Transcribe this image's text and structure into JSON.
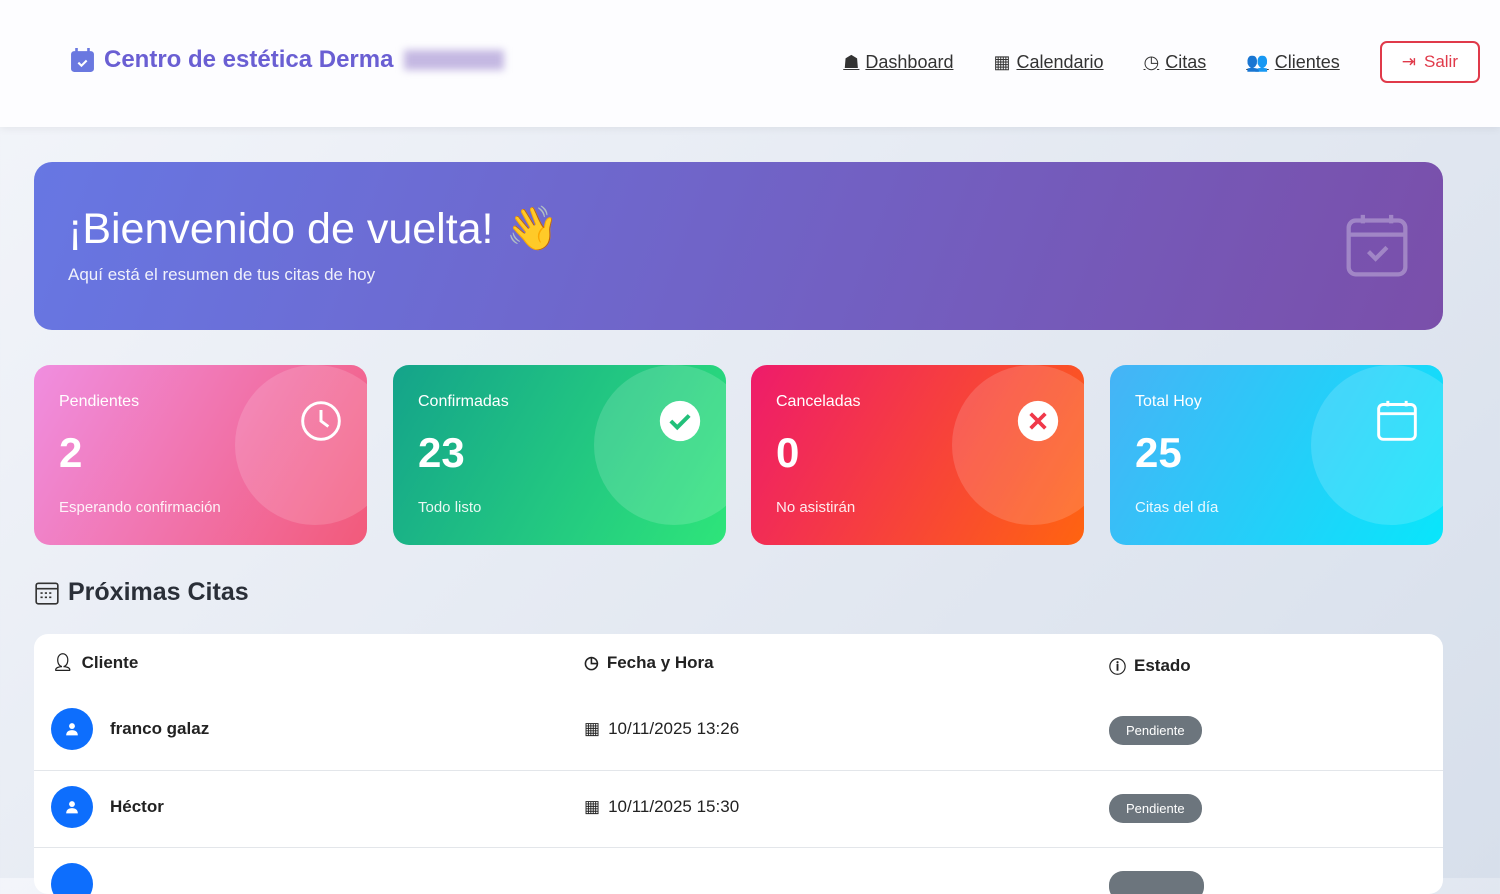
{
  "header": {
    "brand": "Centro de estética Derma",
    "nav": [
      {
        "label": "Dashboard",
        "icon": "home-icon"
      },
      {
        "label": "Calendario",
        "icon": "calendar-icon"
      },
      {
        "label": "Citas",
        "icon": "clock-icon"
      },
      {
        "label": "Clientes",
        "icon": "users-icon"
      }
    ],
    "logout": "Salir"
  },
  "hero": {
    "title": "¡Bienvenido de vuelta! 👋",
    "subtitle": "Aquí está el resumen de tus citas de hoy"
  },
  "stats": [
    {
      "title": "Pendientes",
      "value": "2",
      "sub": "Esperando confirmación"
    },
    {
      "title": "Confirmadas",
      "value": "23",
      "sub": "Todo listo"
    },
    {
      "title": "Canceladas",
      "value": "0",
      "sub": "No asistirán"
    },
    {
      "title": "Total Hoy",
      "value": "25",
      "sub": "Citas del día"
    }
  ],
  "section": {
    "title": "Próximas Citas"
  },
  "table": {
    "headers": [
      "Cliente",
      "Fecha y Hora",
      "Estado"
    ],
    "rows": [
      {
        "client": "franco galaz",
        "datetime": "10/11/2025 13:26",
        "status": "Pendiente"
      },
      {
        "client": "Héctor",
        "datetime": "10/11/2025 15:30",
        "status": "Pendiente"
      }
    ]
  }
}
